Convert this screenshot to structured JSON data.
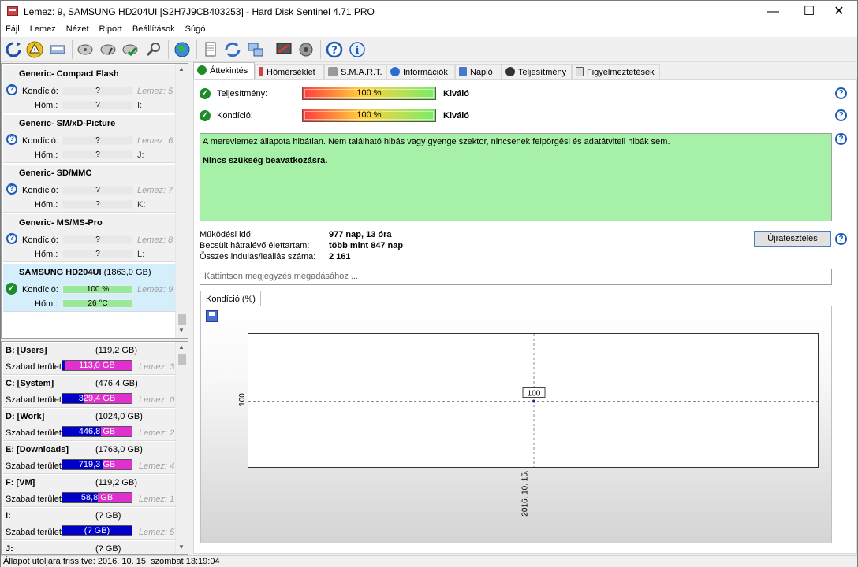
{
  "window": {
    "title": "Lemez: 9, SAMSUNG HD204UI [S2H7J9CB403253]  -  Hard Disk Sentinel 4.71 PRO",
    "minimize": "—",
    "maximize": "☐",
    "close": "✕"
  },
  "menu": [
    "Fájl",
    "Lemez",
    "Nézet",
    "Riport",
    "Beállítások",
    "Súgó"
  ],
  "toolbar": [
    "refresh-icon",
    "alert-icon",
    "drive-icon",
    "test-icon",
    "test2-icon",
    "test3-icon",
    "search-icon",
    "globe-icon",
    "report-icon",
    "copy-icon",
    "network-icon",
    "monitor-icon",
    "speaker-icon",
    "help-icon",
    "info-icon"
  ],
  "devices": [
    {
      "name": "Generic- Compact Flash",
      "size": "",
      "cond_label": "Kondíció:",
      "temp_label": "Hőm.:",
      "cond": "?",
      "temp": "?",
      "disk": "Lemez: 5",
      "letter": "I:",
      "status": "unknown"
    },
    {
      "name": "Generic- SM/xD-Picture",
      "size": "",
      "cond_label": "Kondíció:",
      "temp_label": "Hőm.:",
      "cond": "?",
      "temp": "?",
      "disk": "Lemez: 6",
      "letter": "J:",
      "status": "unknown"
    },
    {
      "name": "Generic- SD/MMC",
      "size": "",
      "cond_label": "Kondíció:",
      "temp_label": "Hőm.:",
      "cond": "?",
      "temp": "?",
      "disk": "Lemez: 7",
      "letter": "K:",
      "status": "unknown"
    },
    {
      "name": "Generic- MS/MS-Pro",
      "size": "",
      "cond_label": "Kondíció:",
      "temp_label": "Hőm.:",
      "cond": "?",
      "temp": "?",
      "disk": "Lemez: 8",
      "letter": "L:",
      "status": "unknown"
    },
    {
      "name": "SAMSUNG HD204UI",
      "size": "(1863,0 GB)",
      "cond_label": "Kondíció:",
      "temp_label": "Hőm.:",
      "cond": "100 %",
      "temp": "26 °C",
      "disk": "Lemez: 9",
      "letter": "",
      "status": "ok"
    }
  ],
  "volumes": [
    {
      "name": "B: [Users]",
      "size": "(119,2 GB)",
      "free_label": "Szabad terület",
      "free": "113,0 GB",
      "disk": "Lemez: 3",
      "free_fraction": 0.95
    },
    {
      "name": "C: [System]",
      "size": "(476,4 GB)",
      "free_label": "Szabad terület",
      "free": "329,4 GB",
      "disk": "Lemez: 0",
      "free_fraction": 0.69
    },
    {
      "name": "D: [Work]",
      "size": "(1024,0 GB)",
      "free_label": "Szabad terület",
      "free": "446,8 GB",
      "disk": "Lemez: 2",
      "free_fraction": 0.44
    },
    {
      "name": "E: [Downloads]",
      "size": "(1763,0 GB)",
      "free_label": "Szabad terület",
      "free": "719,3 GB",
      "disk": "Lemez: 4",
      "free_fraction": 0.41
    },
    {
      "name": "F: [VM]",
      "size": "(119,2 GB)",
      "free_label": "Szabad terület",
      "free": "58,8 GB",
      "disk": "Lemez: 1",
      "free_fraction": 0.49
    },
    {
      "name": "I:",
      "size": "(? GB)",
      "free_label": "Szabad terület",
      "free": "(? GB)",
      "disk": "Lemez: 5",
      "free_fraction": 0
    },
    {
      "name": "J:",
      "size": "(? GB)",
      "free_label": "",
      "free": "",
      "disk": "",
      "free_fraction": 0
    }
  ],
  "tabs": [
    "Áttekintés",
    "Hőmérséklet",
    "S.M.A.R.T.",
    "Információk",
    "Napló",
    "Teljesítmény",
    "Figyelmeztetések"
  ],
  "overview": {
    "perf_label": "Teljesítmény:",
    "perf_value": "100 %",
    "perf_text": "Kiváló",
    "cond_label": "Kondíció:",
    "cond_value": "100 %",
    "cond_text": "Kiváló",
    "status_text": "A merevlemez állapota hibátlan. Nem található hibás vagy gyenge szektor, nincsenek felpörgési és adatátviteli hibák sem.",
    "status_bold": "Nincs szükség beavatkozásra.",
    "uptime_label": "Működési idő:",
    "uptime": "977 nap, 13 óra",
    "remaining_label": "Becsült hátralévő élettartam:",
    "remaining": "több mint 847 nap",
    "starts_label": "Összes indulás/leállás száma:",
    "starts": "2 161",
    "retest": "Újratesztelés",
    "note_placeholder": "Kattintson megjegyzés megadásához ..."
  },
  "chart_tab": "Kondíció  (%)",
  "chart_data": {
    "type": "line",
    "x": [
      "2016. 10. 15."
    ],
    "values": [
      100
    ],
    "point_label": "100",
    "ytick": "100",
    "xtick": "2016. 10. 15."
  },
  "statusbar": "Állapot utoljára frissítve: 2016. 10. 15. szombat 13:19:04"
}
